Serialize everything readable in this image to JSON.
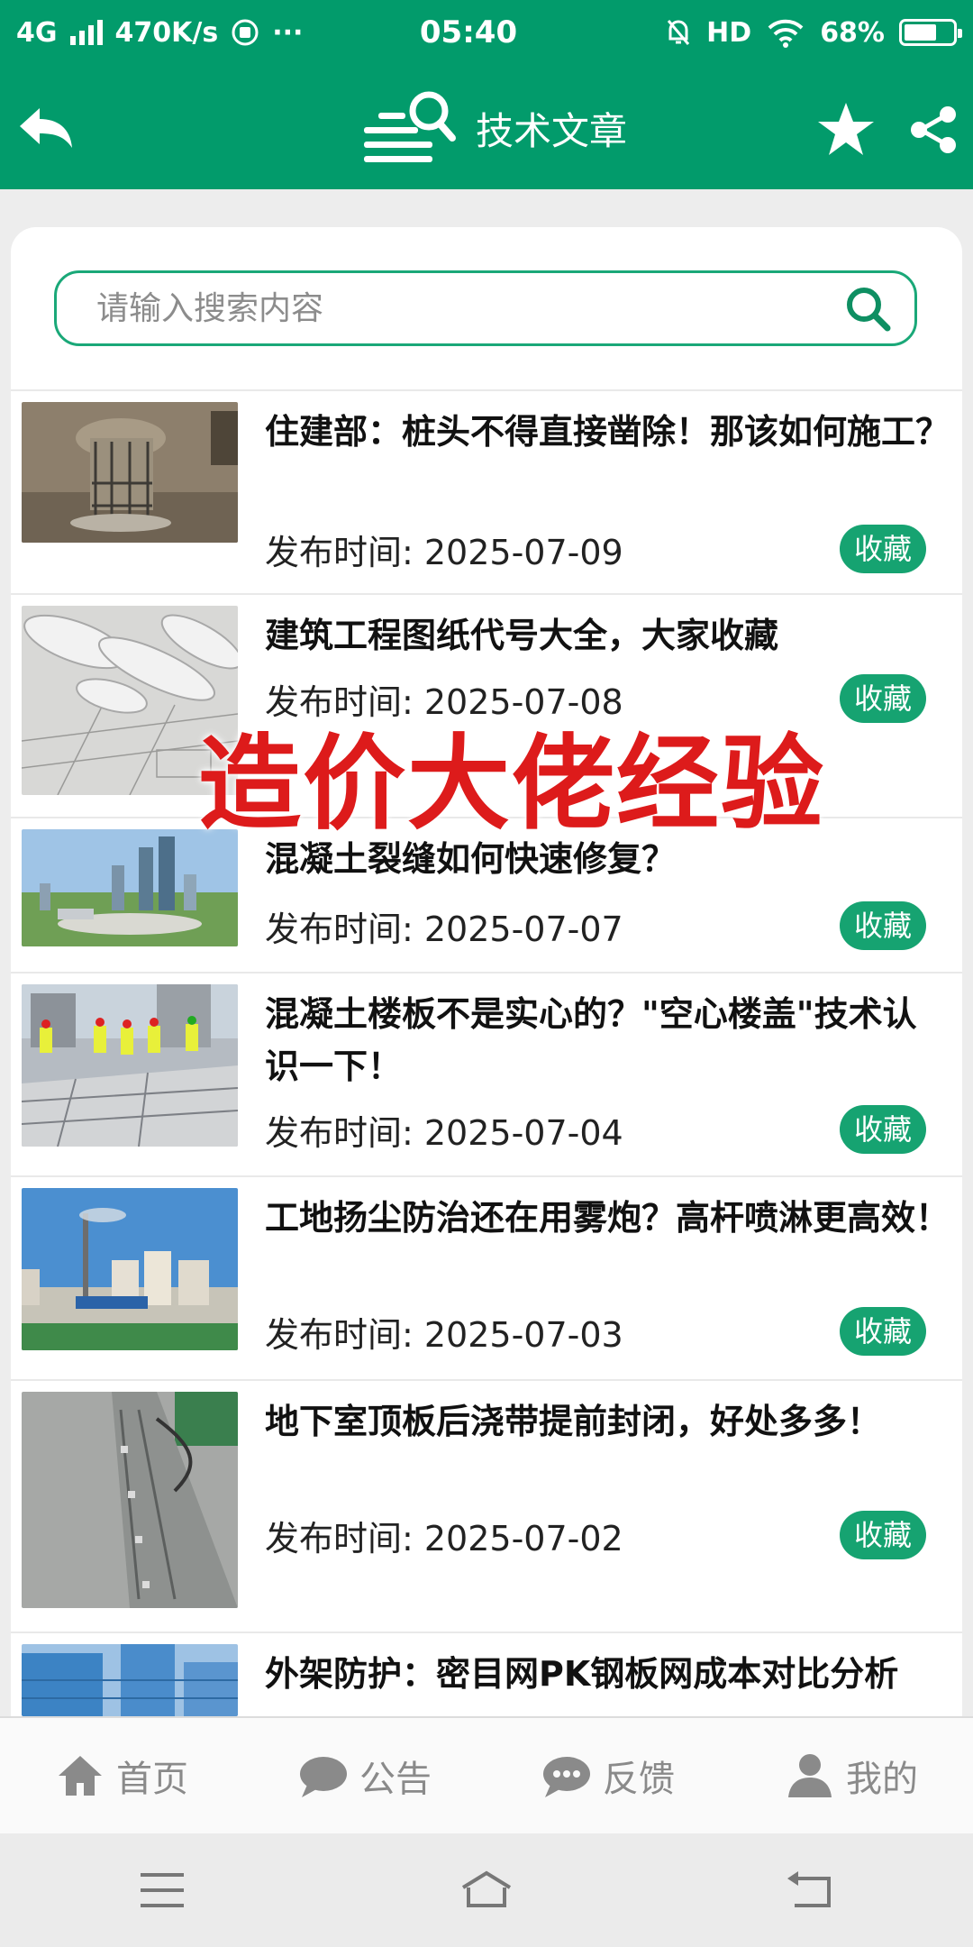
{
  "status_bar": {
    "network": "4G",
    "speed": "470K/s",
    "time": "05:40",
    "hd": "HD",
    "battery": "68%",
    "battery_level": 0.68,
    "more": "···"
  },
  "header": {
    "title": "技术文章"
  },
  "search": {
    "placeholder": "请输入搜索内容"
  },
  "articles": [
    {
      "title": "住建部：桩头不得直接凿除！那该如何施工？",
      "date": "发布时间: 2025-07-09",
      "fav": "收藏",
      "thumb": "pile-head"
    },
    {
      "title": "建筑工程图纸代号大全，大家收藏",
      "date": "发布时间: 2025-07-08",
      "fav": "收藏",
      "thumb": "blueprints"
    },
    {
      "title": "混凝土裂缝如何快速修复？",
      "date": "发布时间: 2025-07-07",
      "fav": "收藏",
      "thumb": "city-aerial"
    },
    {
      "title": "混凝土楼板不是实心的？\"空心楼盖\"技术认识一下！",
      "date": "发布时间: 2025-07-04",
      "fav": "收藏",
      "thumb": "workers-slab"
    },
    {
      "title": "工地扬尘防治还在用雾炮？高杆喷淋更高效！",
      "date": "发布时间: 2025-07-03",
      "fav": "收藏",
      "thumb": "mist-tower"
    },
    {
      "title": "地下室顶板后浇带提前封闭，好处多多！",
      "date": "发布时间: 2025-07-02",
      "fav": "收藏",
      "thumb": "basement-slab"
    },
    {
      "title": "外架防护：密目网PK钢板网成本对比分析",
      "date": "",
      "fav": "",
      "thumb": "scaffold"
    }
  ],
  "overlay_text": "造价大佬经验",
  "bottom_nav": [
    {
      "label": "首页",
      "icon": "home-icon"
    },
    {
      "label": "公告",
      "icon": "chat-bubble-icon"
    },
    {
      "label": "反馈",
      "icon": "feedback-icon"
    },
    {
      "label": "我的",
      "icon": "user-icon"
    }
  ],
  "colors": {
    "brand": "#029b6b",
    "fav_badge": "#16a371",
    "overlay": "#dd1b1b"
  }
}
